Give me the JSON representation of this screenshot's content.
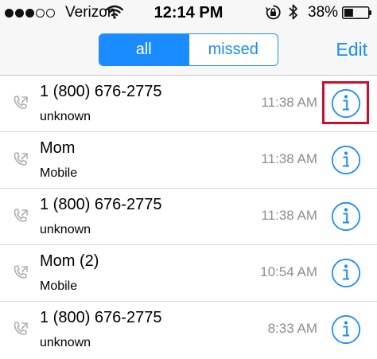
{
  "status_bar": {
    "carrier": "Verizon",
    "time": "12:14 PM",
    "battery_percent": "38%",
    "battery_level": 0.38,
    "signal_bars_filled": 3,
    "signal_bars_total": 5,
    "icons": [
      "wifi-icon",
      "orientation-lock-icon",
      "bluetooth-icon",
      "battery-icon"
    ]
  },
  "nav": {
    "segments": [
      {
        "label": "all",
        "active": true
      },
      {
        "label": "missed",
        "active": false
      }
    ],
    "edit_label": "Edit"
  },
  "colors": {
    "accent": "#1a8cff",
    "secondary_text": "#8e8e93",
    "highlight": "#c8102e"
  },
  "calls": [
    {
      "name": "1 (800) 676-2775",
      "sub": "unknown",
      "time": "11:38 AM",
      "highlighted": true
    },
    {
      "name": "Mom",
      "sub": "Mobile",
      "time": "11:38 AM",
      "highlighted": false
    },
    {
      "name": "1 (800) 676-2775",
      "sub": "unknown",
      "time": "11:38 AM",
      "highlighted": false
    },
    {
      "name": "Mom  (2)",
      "sub": "Mobile",
      "time": "10:54 AM",
      "highlighted": false
    },
    {
      "name": "1 (800) 676-2775",
      "sub": "unknown",
      "time": "8:33 AM",
      "highlighted": false
    }
  ]
}
